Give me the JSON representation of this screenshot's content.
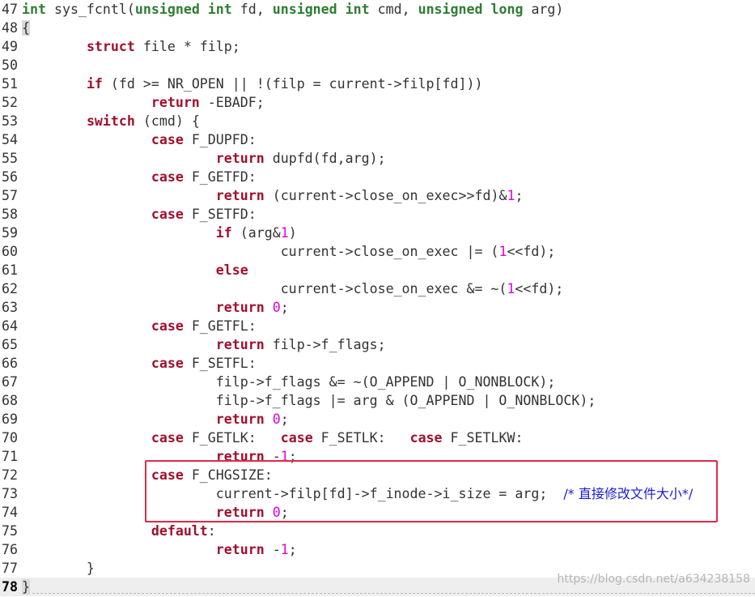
{
  "lines": [
    {
      "n": "47",
      "tokens": [
        {
          "t": "int",
          "c": "typ"
        },
        {
          "t": " sys_fcntl(",
          "c": "fn"
        },
        {
          "t": "unsigned int",
          "c": "typ"
        },
        {
          "t": " fd, ",
          "c": "fn"
        },
        {
          "t": "unsigned int",
          "c": "typ"
        },
        {
          "t": " cmd, ",
          "c": "fn"
        },
        {
          "t": "unsigned long",
          "c": "typ"
        },
        {
          "t": " arg)",
          "c": "fn"
        }
      ]
    },
    {
      "n": "48",
      "tokens": [
        {
          "t": "{",
          "c": "brace-hl"
        }
      ]
    },
    {
      "n": "49",
      "tokens": [
        {
          "t": "        "
        },
        {
          "t": "struct",
          "c": "kw"
        },
        {
          "t": " file * filp;"
        }
      ]
    },
    {
      "n": "50",
      "tokens": []
    },
    {
      "n": "51",
      "tokens": [
        {
          "t": "        "
        },
        {
          "t": "if",
          "c": "kw"
        },
        {
          "t": " (fd >= NR_OPEN || !(filp = current->filp[fd]))"
        }
      ]
    },
    {
      "n": "52",
      "tokens": [
        {
          "t": "                "
        },
        {
          "t": "return",
          "c": "kw"
        },
        {
          "t": " -EBADF;"
        }
      ]
    },
    {
      "n": "53",
      "tokens": [
        {
          "t": "        "
        },
        {
          "t": "switch",
          "c": "kw"
        },
        {
          "t": " (cmd) {"
        }
      ]
    },
    {
      "n": "54",
      "tokens": [
        {
          "t": "                "
        },
        {
          "t": "case",
          "c": "kw"
        },
        {
          "t": " F_DUPFD:"
        }
      ]
    },
    {
      "n": "55",
      "tokens": [
        {
          "t": "                        "
        },
        {
          "t": "return",
          "c": "kw"
        },
        {
          "t": " dupfd(fd,arg);"
        }
      ]
    },
    {
      "n": "56",
      "tokens": [
        {
          "t": "                "
        },
        {
          "t": "case",
          "c": "kw"
        },
        {
          "t": " F_GETFD:"
        }
      ]
    },
    {
      "n": "57",
      "tokens": [
        {
          "t": "                        "
        },
        {
          "t": "return",
          "c": "kw"
        },
        {
          "t": " (current->close_on_exec>>fd)&"
        },
        {
          "t": "1",
          "c": "num"
        },
        {
          "t": ";"
        }
      ]
    },
    {
      "n": "58",
      "tokens": [
        {
          "t": "                "
        },
        {
          "t": "case",
          "c": "kw"
        },
        {
          "t": " F_SETFD:"
        }
      ]
    },
    {
      "n": "59",
      "tokens": [
        {
          "t": "                        "
        },
        {
          "t": "if",
          "c": "kw"
        },
        {
          "t": " (arg&"
        },
        {
          "t": "1",
          "c": "num"
        },
        {
          "t": ")"
        }
      ]
    },
    {
      "n": "60",
      "tokens": [
        {
          "t": "                                current->close_on_exec |= ("
        },
        {
          "t": "1",
          "c": "num"
        },
        {
          "t": "<<fd);"
        }
      ]
    },
    {
      "n": "61",
      "tokens": [
        {
          "t": "                        "
        },
        {
          "t": "else",
          "c": "kw"
        }
      ]
    },
    {
      "n": "62",
      "tokens": [
        {
          "t": "                                current->close_on_exec &= ~("
        },
        {
          "t": "1",
          "c": "num"
        },
        {
          "t": "<<fd);"
        }
      ]
    },
    {
      "n": "63",
      "tokens": [
        {
          "t": "                        "
        },
        {
          "t": "return",
          "c": "kw"
        },
        {
          "t": " "
        },
        {
          "t": "0",
          "c": "num"
        },
        {
          "t": ";"
        }
      ]
    },
    {
      "n": "64",
      "tokens": [
        {
          "t": "                "
        },
        {
          "t": "case",
          "c": "kw"
        },
        {
          "t": " F_GETFL:"
        }
      ]
    },
    {
      "n": "65",
      "tokens": [
        {
          "t": "                        "
        },
        {
          "t": "return",
          "c": "kw"
        },
        {
          "t": " filp->f_flags;"
        }
      ]
    },
    {
      "n": "66",
      "tokens": [
        {
          "t": "                "
        },
        {
          "t": "case",
          "c": "kw"
        },
        {
          "t": " F_SETFL:"
        }
      ]
    },
    {
      "n": "67",
      "tokens": [
        {
          "t": "                        filp->f_flags &= ~(O_APPEND | O_NONBLOCK);"
        }
      ]
    },
    {
      "n": "68",
      "tokens": [
        {
          "t": "                        filp->f_flags |= arg & (O_APPEND | O_NONBLOCK);"
        }
      ]
    },
    {
      "n": "69",
      "tokens": [
        {
          "t": "                        "
        },
        {
          "t": "return",
          "c": "kw"
        },
        {
          "t": " "
        },
        {
          "t": "0",
          "c": "num"
        },
        {
          "t": ";"
        }
      ]
    },
    {
      "n": "70",
      "tokens": [
        {
          "t": "                "
        },
        {
          "t": "case",
          "c": "kw"
        },
        {
          "t": " F_GETLK:   "
        },
        {
          "t": "case",
          "c": "kw"
        },
        {
          "t": " F_SETLK:   "
        },
        {
          "t": "case",
          "c": "kw"
        },
        {
          "t": " F_SETLKW:"
        }
      ]
    },
    {
      "n": "71",
      "tokens": [
        {
          "t": "                        "
        },
        {
          "t": "return",
          "c": "kw"
        },
        {
          "t": " -"
        },
        {
          "t": "1",
          "c": "num"
        },
        {
          "t": ";"
        }
      ]
    },
    {
      "n": "72",
      "tokens": [
        {
          "t": "                "
        },
        {
          "t": "case",
          "c": "kw"
        },
        {
          "t": " F_CHGSIZE:"
        }
      ]
    },
    {
      "n": "73",
      "tokens": [
        {
          "t": "                        current->filp[fd]->f_inode->i_size = arg;  "
        },
        {
          "t": "/* 直接修改文件大小*/",
          "c": "cmt"
        }
      ]
    },
    {
      "n": "74",
      "tokens": [
        {
          "t": "                        "
        },
        {
          "t": "return",
          "c": "kw"
        },
        {
          "t": " "
        },
        {
          "t": "0",
          "c": "num"
        },
        {
          "t": ";"
        }
      ]
    },
    {
      "n": "75",
      "tokens": [
        {
          "t": "                "
        },
        {
          "t": "default",
          "c": "kw"
        },
        {
          "t": ":"
        }
      ]
    },
    {
      "n": "76",
      "tokens": [
        {
          "t": "                        "
        },
        {
          "t": "return",
          "c": "kw"
        },
        {
          "t": " -"
        },
        {
          "t": "1",
          "c": "num"
        },
        {
          "t": ";"
        }
      ]
    },
    {
      "n": "77",
      "tokens": [
        {
          "t": "        }"
        }
      ]
    },
    {
      "n": "78",
      "tokens": [
        {
          "t": "}",
          "c": "brace-hl"
        }
      ],
      "current": true
    }
  ],
  "watermark": "https://blog.csdn.net/a634238158",
  "colors": {
    "keyword": "#a0102e",
    "type": "#2e7d32",
    "number": "#e000e0",
    "comment": "#1a1ad8",
    "highlight_box": "#e0294a"
  }
}
